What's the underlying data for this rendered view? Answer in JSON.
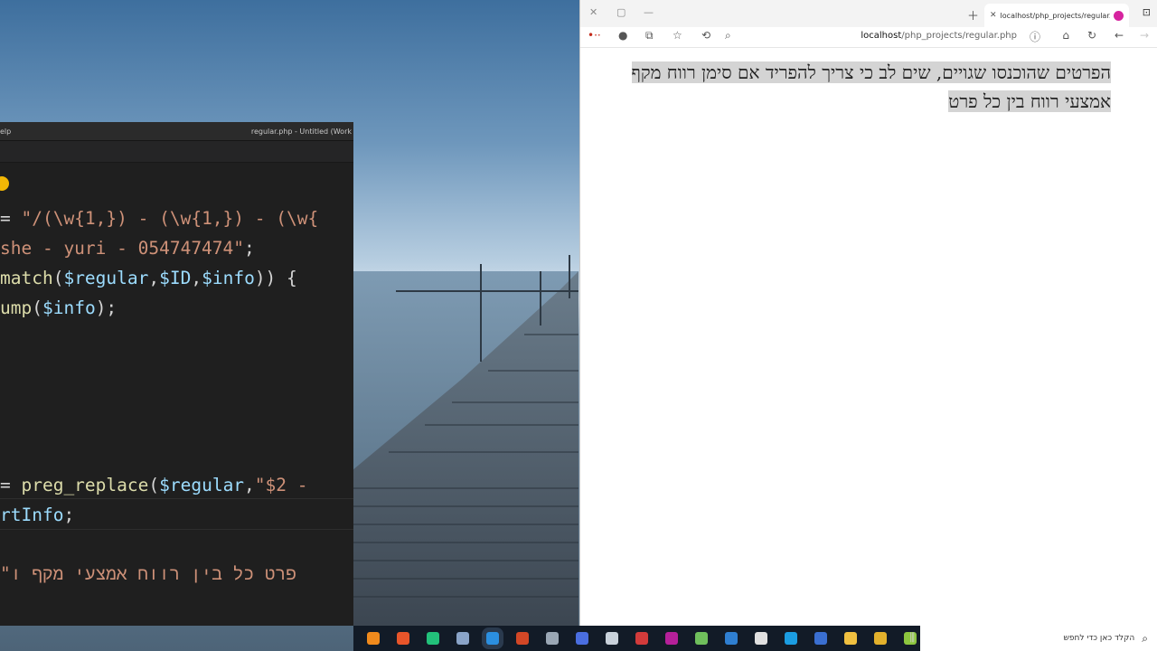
{
  "editor": {
    "title_left": "elp",
    "title_right": "regular.php - Untitled (Work",
    "code_lines": [
      {
        "parts": [
          [
            "op",
            "= "
          ],
          [
            "str",
            "\"/(\\w{1,}) - (\\w{1,}) - (\\w{"
          ]
        ]
      },
      {
        "parts": [
          [
            "str",
            "she - yuri - 054747474\""
          ],
          [
            "op",
            ";"
          ]
        ]
      },
      {
        "parts": [
          [
            "fn",
            "match"
          ],
          [
            "op",
            "("
          ],
          [
            "var",
            "$regular"
          ],
          [
            "op",
            ","
          ],
          [
            "var",
            "$ID"
          ],
          [
            "op",
            ","
          ],
          [
            "var",
            "$info"
          ],
          [
            "op",
            ")) {"
          ]
        ]
      },
      {
        "parts": [
          [
            "fn",
            "ump"
          ],
          [
            "op",
            "("
          ],
          [
            "var",
            "$info"
          ],
          [
            "op",
            ");"
          ]
        ]
      },
      {
        "parts": [
          [
            "op",
            "= "
          ],
          [
            "fn",
            "preg_replace"
          ],
          [
            "op",
            "("
          ],
          [
            "var",
            "$regular"
          ],
          [
            "op",
            ","
          ],
          [
            "str",
            "\"$2 -"
          ]
        ]
      },
      {
        "parts": [
          [
            "var",
            "rtInfo"
          ],
          [
            "op",
            ";"
          ]
        ]
      },
      {
        "parts": [
          [
            "str",
            "\"פרט כל בין רווח אמצעי מקף ו"
          ]
        ]
      }
    ]
  },
  "browser": {
    "tab_title": "localhost/php_projects/regular.p",
    "url_host": "localhost",
    "url_path": "/php_projects/regular.php",
    "page_text": "הפרטים שהוכנסו שגויים, שים לב כי צריך להפריד אם סימן רווח מקף אמצעי רווח בין כל פרט"
  },
  "taskbar": {
    "search_placeholder": "הקלד כאן כדי לחפש",
    "icons": [
      {
        "name": "vlc-icon",
        "color": "#f08a1c"
      },
      {
        "name": "firefox-icon",
        "color": "#e8552a"
      },
      {
        "name": "pycharm-icon",
        "color": "#22c17a"
      },
      {
        "name": "notepad-icon",
        "color": "#8aa4c8"
      },
      {
        "name": "vscode-icon",
        "color": "#2b8fe0"
      },
      {
        "name": "powerpoint-icon",
        "color": "#d24726"
      },
      {
        "name": "app-icon",
        "color": "#9aa7b5"
      },
      {
        "name": "app-icon",
        "color": "#4a6ee0"
      },
      {
        "name": "app-icon",
        "color": "#c9d2db"
      },
      {
        "name": "app-icon",
        "color": "#d23b3b"
      },
      {
        "name": "app-icon",
        "color": "#b5209a"
      },
      {
        "name": "app-icon",
        "color": "#6fbf5c"
      },
      {
        "name": "mail-icon",
        "color": "#2f7fd1"
      },
      {
        "name": "app-icon",
        "color": "#e0e0e0"
      },
      {
        "name": "edge-icon",
        "color": "#1b9de2"
      },
      {
        "name": "app-icon",
        "color": "#3a6fd1"
      },
      {
        "name": "folder-icon",
        "color": "#f0c040"
      },
      {
        "name": "chrome-icon",
        "color": "#e3b12c"
      },
      {
        "name": "notepadpp-icon",
        "color": "#8dc63f"
      }
    ]
  }
}
